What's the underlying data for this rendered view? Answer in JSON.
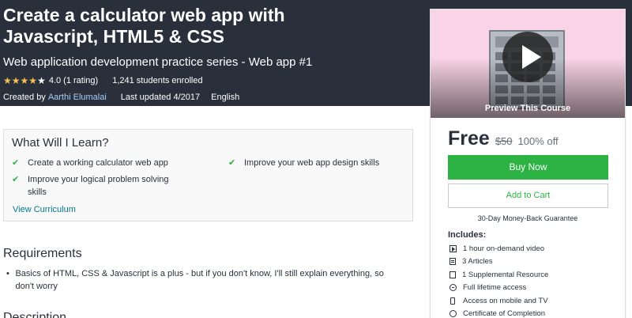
{
  "course": {
    "title_line1": "Create a calculator web app with",
    "title_line2": "Javascript, HTML5 & CSS",
    "subtitle": "Web application development practice series - Web app #1",
    "rating_value": "4.0",
    "rating_text": "4.0 (1 rating)",
    "rating_stars": 4,
    "enrolled": "1,241 students enrolled",
    "created_by_label": "Created by",
    "author": "Aarthi Elumalai",
    "last_updated": "Last updated 4/2017",
    "language": "English"
  },
  "card": {
    "preview_label": "Preview This Course",
    "price": "Free",
    "original_price": "$50",
    "discount": "100% off",
    "buy_label": "Buy Now",
    "cart_label": "Add to Cart",
    "guarantee": "30-Day Money-Back Guarantee",
    "includes_title": "Includes:",
    "includes": [
      {
        "icon": "video-icon",
        "text": "1 hour on-demand video"
      },
      {
        "icon": "article-icon",
        "text": "3 Articles"
      },
      {
        "icon": "file-icon",
        "text": "1 Supplemental Resource"
      },
      {
        "icon": "infinity-icon",
        "text": "Full lifetime access"
      },
      {
        "icon": "mobile-icon",
        "text": "Access on mobile and TV"
      },
      {
        "icon": "certificate-icon",
        "text": "Certificate of Completion"
      }
    ]
  },
  "learn": {
    "title": "What Will I Learn?",
    "items": [
      "Create a working calculator web app",
      "Improve your web app design skills",
      "Improve your logical problem solving skills"
    ],
    "view_curriculum": "View Curriculum"
  },
  "requirements": {
    "title": "Requirements",
    "items": [
      "Basics of HTML, CSS & Javascript is a plus - but if you don't know, I'll still explain everything, so don't worry"
    ]
  },
  "next_section": {
    "title": "Description"
  },
  "colors": {
    "hero_bg": "#29303b",
    "accent_green": "#2cb343",
    "link_blue": "#007791",
    "star_gold": "#f4c150",
    "preview_bg": "#f9d4e6"
  }
}
